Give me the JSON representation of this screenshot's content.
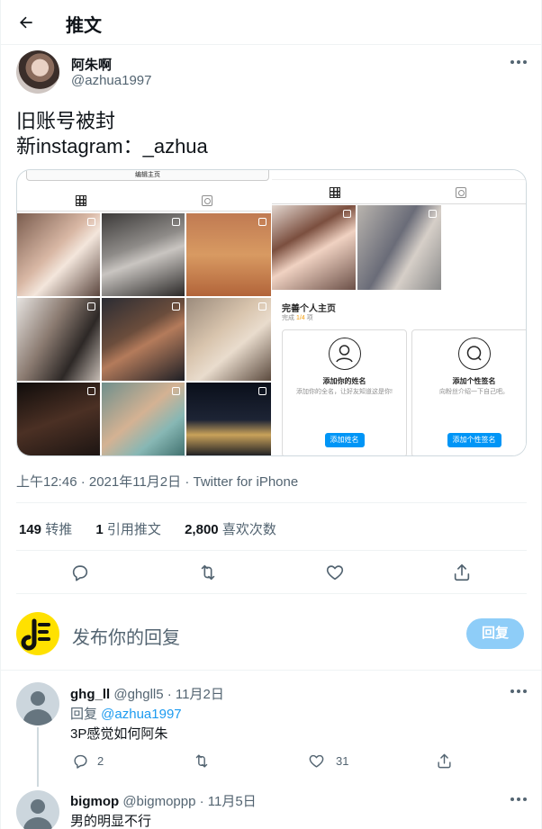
{
  "header": {
    "title": "推文"
  },
  "tweet": {
    "author_name": "阿朱啊",
    "author_handle": "@azhua1997",
    "text_line1": "旧账号被封",
    "text_line2": "新instagram：_azhua",
    "meta": "上午12:46 · 2021年11月2日 · Twitter for iPhone",
    "stats": {
      "retweets_value": "149",
      "retweets_label": "转推",
      "quotes_value": "1",
      "quotes_label": "引用推文",
      "likes_value": "2,800",
      "likes_label": "喜欢次数"
    }
  },
  "media": {
    "edit_profile_label": "编辑主页",
    "complete_title": "完善个人主页",
    "complete_sub_prefix": "完成 ",
    "complete_sub_progress": "1/4",
    "complete_sub_suffix": " 项",
    "card_name": {
      "title": "添加你的姓名",
      "desc": "添加你的全名，让好友知道这是你!",
      "button": "添加姓名"
    },
    "card_bio": {
      "title": "添加个性签名",
      "desc": "向粉丝介绍一下自己吧。",
      "button": "添加个性签名"
    }
  },
  "reply_box": {
    "placeholder": "发布你的回复",
    "button": "回复"
  },
  "replies": [
    {
      "name": "ghg_ll",
      "handle_date": "@ghgll5 · 11月2日",
      "reply_prefix": "回复 ",
      "reply_to": "@azhua1997",
      "text": "3P感觉如何阿朱",
      "reply_count": "2",
      "like_count": "31"
    },
    {
      "name": "bigmop",
      "handle_date": "@bigmoppp · 11月5日",
      "text": "男的明显不行"
    }
  ],
  "icons": {
    "back": "arrow-left-icon",
    "more": "more-horizontal-icon",
    "reply": "comment-icon",
    "retweet": "retweet-icon",
    "like": "heart-icon",
    "share": "share-icon"
  },
  "colors": {
    "accent": "#1d9bf0",
    "secondary_text": "#536471",
    "reply_button": "#8ecdf8"
  }
}
